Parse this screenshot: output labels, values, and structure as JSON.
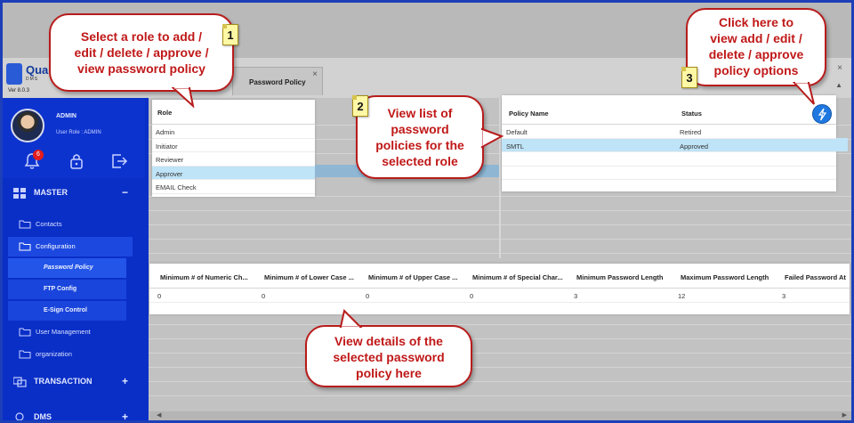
{
  "app": {
    "name": "Qua",
    "sub": "DMS",
    "version": "Ver 8.0.3"
  },
  "tab": {
    "label": "Password Policy",
    "close": "×"
  },
  "window": {
    "close": "×",
    "ctrl": "▲"
  },
  "user": {
    "name": "ADMIN",
    "role": "User Role : ADMIN",
    "notification_count": "6"
  },
  "menu": {
    "master": {
      "label": "MASTER",
      "toggle": "−"
    },
    "contacts": "Contacts",
    "configuration": "Configuration",
    "password_policy": "Password Policy",
    "ftp_config": "FTP Config",
    "esign_control": "E-Sign Control",
    "user_management": "User Management",
    "organization": "organization",
    "transaction": {
      "label": "TRANSACTION",
      "toggle": "+"
    },
    "dms": {
      "label": "DMS",
      "toggle": "+"
    }
  },
  "roles": {
    "header": "Role",
    "items": [
      "Admin",
      "Initiator",
      "Reviewer",
      "Approver",
      "EMAIL Check"
    ],
    "selected_index": 3
  },
  "policies": {
    "headers": [
      "Policy Name",
      "Status"
    ],
    "rows": [
      {
        "name": "Default",
        "status": "Retired"
      },
      {
        "name": "SMTL",
        "status": "Approved"
      }
    ],
    "selected_index": 1
  },
  "details": {
    "headers": [
      "Minimum # of Numeric Ch...",
      "Minimum # of Lower Case ...",
      "Minimum # of Upper Case ...",
      "Minimum # of Special Char...",
      "Minimum Password Length",
      "Maximum Password Length",
      "Failed Password At"
    ],
    "values": [
      "0",
      "0",
      "0",
      "0",
      "3",
      "12",
      "3"
    ]
  },
  "scroll": {
    "left": "◀",
    "right": "▶"
  },
  "callouts": {
    "c1": {
      "number": "1",
      "lines": [
        "Select a role to add /",
        "edit / delete / approve /",
        "view password policy"
      ]
    },
    "c2": {
      "number": "2",
      "lines": [
        "View list of",
        "password",
        "policies for the",
        "selected role"
      ]
    },
    "c3": {
      "number": "3",
      "lines": [
        "Click here to",
        "view add / edit /",
        "delete / approve",
        "policy options"
      ]
    },
    "c4": {
      "lines": [
        "View details of the",
        "selected password",
        "policy here"
      ]
    }
  },
  "colors": {
    "sidebar": "#0a2fc7",
    "selection": "#bfe3f7",
    "callout_text": "#c01818",
    "frame": "#1d3fb8"
  }
}
